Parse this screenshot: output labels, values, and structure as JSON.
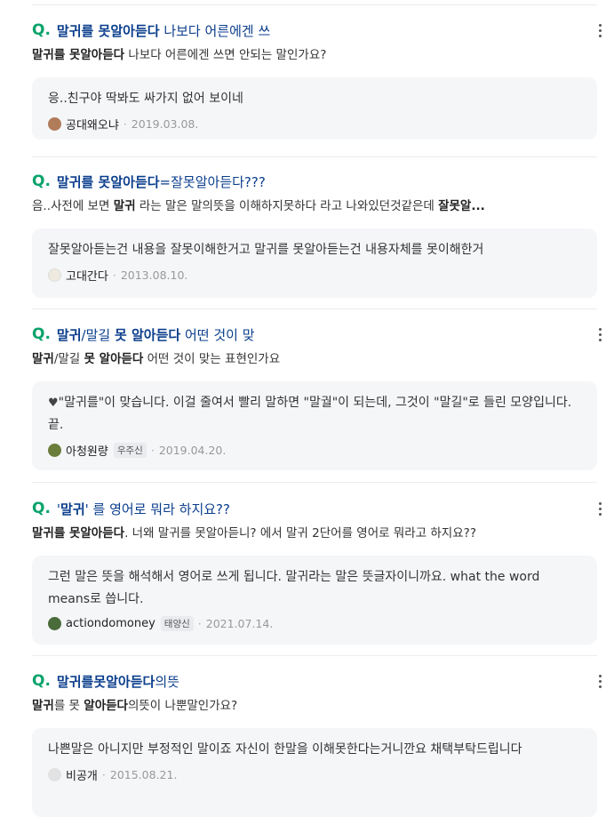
{
  "more_icon": "more-vertical-icon",
  "items": [
    {
      "title_hl": "말귀를 못알아듣다",
      "title_rest": " 나보다 어른에겐 쓰",
      "sub_hl": "말귀를 못알아듣다",
      "sub_rest": " 나보다 어른에겐 쓰면 안되는 말인가요?",
      "answer": "응..친구야 딱봐도 싸가지 없어 보이네",
      "author": "공대왜오냐",
      "badge": "",
      "date": "2019.03.08.",
      "avatar_color": "#b07c5a"
    },
    {
      "title_hl": "말귀를 못알아듣다",
      "title_rest": "=잘못알아듣다???",
      "sub_prefix": "음..사전에 보면 ",
      "sub_hl": "말귀",
      "sub_rest": " 라는 말은 말의뜻을 이해하지못하다 라고 나와있던것같은데 ",
      "sub_hl2": "잘못알...",
      "answer": "잘못알아듣는건 내용을 잘못이해한거고 말귀를 못알아듣는건 내용자체를 못이해한거",
      "author": "고대간다",
      "badge": "",
      "date": "2013.08.10.",
      "avatar_color": "#e6e0cf"
    },
    {
      "title_hl": "말귀",
      "title_mid": "/말길 ",
      "title_hl2": "못 알아듣다",
      "title_rest": " 어떤 것이 맞",
      "sub_hl": "말귀",
      "sub_mid": "/말길 ",
      "sub_hl2": "못 알아듣다",
      "sub_rest": " 어떤 것이 맞는 표현인가요",
      "answer_prefix": "♥",
      "answer": "\"말귀를\"이 맞습니다. 이걸 줄여서 빨리 말하면 \"말궐\"이 되는데, 그것이 \"말길\"로 들린 모양입니다. 끝.",
      "author": "아청원량",
      "badge": "우주신",
      "date": "2019.04.20.",
      "avatar_color": "#6b7d3a"
    },
    {
      "title_pre": "'",
      "title_hl": "말귀",
      "title_rest": "' 를 영어로 뭐라 하지요??",
      "sub_hl": "말귀를 못알아듣다",
      "sub_rest": ". 너왜 말귀를 못알아듣니? 에서 말귀 2단어를 영어로 뭐라고 하지요??",
      "answer": "그런 말은 뜻을 해석해서 영어로 쓰게 됩니다. 말귀라는 말은 뜻글자이니까요. what the word means로 씁니다.",
      "author": "actiondomoney",
      "badge": "태양신",
      "date": "2021.07.14.",
      "avatar_color": "#4a6b3a"
    },
    {
      "title_hl": "말귀를못알아듣다",
      "title_rest": "의뜻",
      "sub_hl": "말귀",
      "sub_mid": "를 못 ",
      "sub_hl2": "알아듣다",
      "sub_rest": "의뜻이 나뿐말인가요?",
      "answer": "나쁜말은 아니지만 부정적인 말이죠 자신이 한말을 이해못한다는거니깐요 채택부탁드립니다",
      "author": "비공개",
      "badge": "",
      "date": "2015.08.21.",
      "avatar_color": "#dcdcdc"
    }
  ],
  "q_mark": "Q.",
  "dot_sep": "·"
}
